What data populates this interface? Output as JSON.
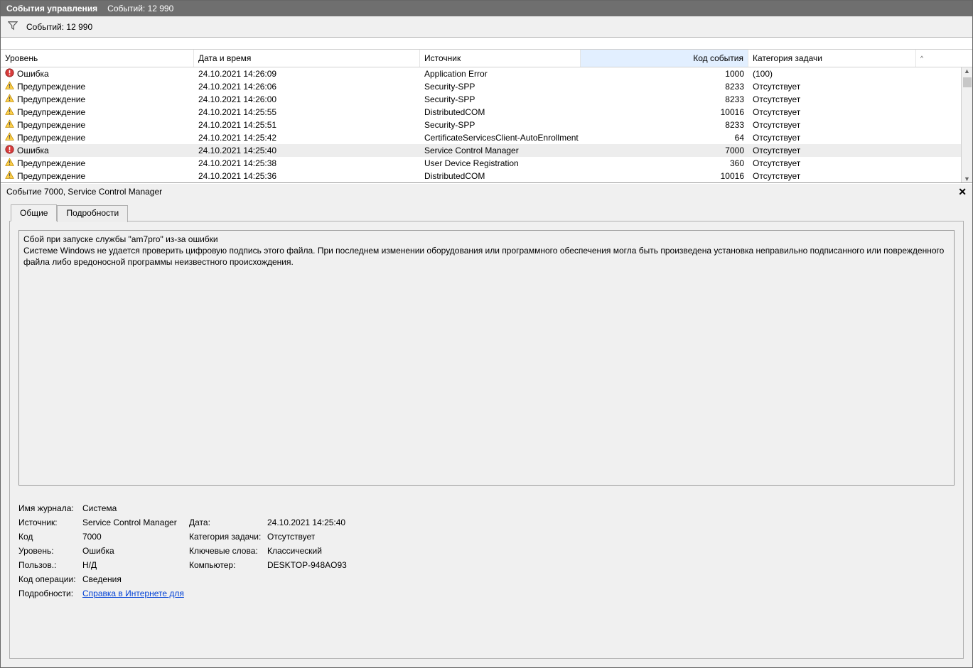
{
  "titlebar": {
    "title": "События управления",
    "count_label": "Событий: 12 990"
  },
  "filterbar": {
    "count_label": "Событий: 12 990"
  },
  "columns": {
    "level": "Уровень",
    "datetime": "Дата и время",
    "source": "Источник",
    "event_id": "Код события",
    "category": "Категория задачи"
  },
  "levels": {
    "error": "Ошибка",
    "warning": "Предупреждение"
  },
  "rows": [
    {
      "lvl": "error",
      "dt": "24.10.2021 14:26:09",
      "src": "Application Error",
      "id": "1000",
      "cat": "(100)"
    },
    {
      "lvl": "warning",
      "dt": "24.10.2021 14:26:06",
      "src": "Security-SPP",
      "id": "8233",
      "cat": "Отсутствует"
    },
    {
      "lvl": "warning",
      "dt": "24.10.2021 14:26:00",
      "src": "Security-SPP",
      "id": "8233",
      "cat": "Отсутствует"
    },
    {
      "lvl": "warning",
      "dt": "24.10.2021 14:25:55",
      "src": "DistributedCOM",
      "id": "10016",
      "cat": "Отсутствует"
    },
    {
      "lvl": "warning",
      "dt": "24.10.2021 14:25:51",
      "src": "Security-SPP",
      "id": "8233",
      "cat": "Отсутствует"
    },
    {
      "lvl": "warning",
      "dt": "24.10.2021 14:25:42",
      "src": "CertificateServicesClient-AutoEnrollment",
      "id": "64",
      "cat": "Отсутствует"
    },
    {
      "lvl": "error",
      "dt": "24.10.2021 14:25:40",
      "src": "Service Control Manager",
      "id": "7000",
      "cat": "Отсутствует",
      "selected": true
    },
    {
      "lvl": "warning",
      "dt": "24.10.2021 14:25:38",
      "src": "User Device Registration",
      "id": "360",
      "cat": "Отсутствует"
    },
    {
      "lvl": "warning",
      "dt": "24.10.2021 14:25:36",
      "src": "DistributedCOM",
      "id": "10016",
      "cat": "Отсутствует"
    }
  ],
  "details": {
    "header": "Событие 7000, Service Control Manager",
    "tabs": {
      "general": "Общие",
      "details": "Подробности"
    },
    "message_line1": "Сбой при запуске службы \"am7pro\" из-за ошибки",
    "message_line2": "Системе Windows не удается проверить цифровую подпись этого файла. При последнем изменении оборудования или программного обеспечения могла быть произведена установка неправильно подписанного или поврежденного файла либо вредоносной программы неизвестного происхождения.",
    "meta": {
      "log_name_label": "Имя журнала:",
      "log_name": "Система",
      "source_label": "Источник:",
      "source": "Service Control Manager",
      "date_label": "Дата:",
      "date": "24.10.2021 14:25:40",
      "code_label": "Код",
      "code": "7000",
      "cat_label": "Категория задачи:",
      "cat": "Отсутствует",
      "level_label": "Уровень:",
      "level": "Ошибка",
      "kw_label": "Ключевые слова:",
      "kw": "Классический",
      "user_label": "Пользов.:",
      "user": "Н/Д",
      "computer_label": "Компьютер:",
      "computer": "DESKTOP-948AO93",
      "opcode_label": "Код операции:",
      "opcode": "Сведения",
      "moreinfo_label": "Подробности:",
      "moreinfo_link": "Справка в Интернете для "
    }
  }
}
